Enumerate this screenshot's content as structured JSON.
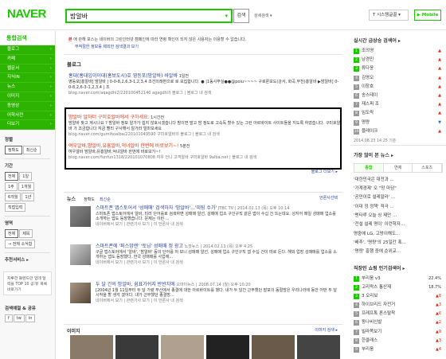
{
  "logo": "NAVER",
  "search": {
    "query": "밤알바",
    "button": "검색",
    "advanced": "상세검색 ▾"
  },
  "header": {
    "system_font": "T 시스템글꼴 ▾",
    "mobile": "▶ Mobile"
  },
  "left_nav": {
    "all": "통합검색",
    "items": [
      "블로그",
      "카페",
      "웹문서",
      "지식iN",
      "뉴스",
      "이미지",
      "동영상",
      "어학사전",
      "더보기"
    ],
    "sort_label": "정렬",
    "sort": [
      "정확도",
      "최신순"
    ],
    "period_label": "기간",
    "period": [
      "전체",
      "1일",
      "1주",
      "1개월",
      "6개월",
      "1년"
    ],
    "period_custom": "직접입력",
    "area_label": "영역",
    "area": [
      "전체",
      "제목"
    ],
    "area_custom": "→ 전체 소식함",
    "recommend_label": "추천서비스 ▸",
    "ad_text": "지루한 들텐드만 업데 달력을 TOP 10 공개! 목록 바로가기",
    "dict_label": "검색예절 & 공유",
    "share": [
      "f",
      "tw",
      "in"
    ]
  },
  "notice": {
    "text": "에 관해 포스는 네이버의 그린인터넷 캠페인에 따라 연령 확인이 되지 않은 사용자는 이용할 수 없습니다.",
    "link": "부적절한 정보를 제외한 검색결과 보기",
    "red": "본"
  },
  "blog": {
    "title": "블로그",
    "items": [
      {
        "title": "홍대(홍대입이이대(홍보도시)호 영등포(밤알바) 바알바",
        "date": "1일전",
        "desc": "영등포[홍알바] 밤알바 | 0-0-8,2,6,3-1,2,3,4 조건의래편으로 로 모집합니다. ● |1동사무실●●@poiu~~~~ 구로론보도(강서, 화곡,부천)홍알바 ▶밤알바] 0-0-8,2,6-3-1,2,3,4 | 조",
        "meta": "blog.naver.com/aqagdhl2/220100452140",
        "src": "agagdh의 블로그  |  블로그 내 검색"
      },
      {
        "title": "밤알바 알차더 구미호알바에서 구하세요.",
        "date": "1시간전",
        "desc": "밤알바 찾고 계시나요 ? 밤알바 정보 알가가 쉽지 않호시겠습니다 밤이면 발고 밤 정도로 고속독 할수 있는 그런 아르바이트 사이트들을 지도록 하였습니다. 구미호알바 가 조금합니다 지금 빨리 구사해서 알가라 얼마보세요",
        "meta": "blog.naver.com/gumihoalba/220101049590",
        "src": "구미호알바의 블로그  |  블로그 내 검색"
      },
      {
        "title": "여우알바,밤알바,유흥알바,억녀알바 한번에 바로보기~!",
        "date": "5분전",
        "desc": "여우알바 밤알바,유흥알바,억녀알바 한번에 바로보기~!",
        "meta": "blog.naver.com/funfun1318/220101070808",
        "src": "여우 언니 고객알바 구미호알바 9alba.net  |  블로그 내 검색"
      }
    ],
    "more": "블로그 더보기 ▸"
  },
  "news": {
    "title": "뉴스",
    "sort": [
      "정확도",
      "최신순"
    ],
    "more": "언론사선택",
    "items": [
      {
        "title": "스마트폰 앱스토어서 '성매매' 검색하자 '밤알바'...'미팅 수가'",
        "src": "JTBC TV  |  2014.02.13 (목) 오후 10:14",
        "desc": "스마트폰 앱스토어에서 알바, 미러 단어를로 검색하면 성매매 알선, 성매매 업소 구인구직 같은 앱이 수십 건 뜨는데요. 성지어 매일 성매매 업소를 소개하는 앱도 등장했습니다. 문제는 이런 ...",
        "foot": "네이버에서 보기  |  관련기사 보기  |  이 언론사 내 검색"
      },
      {
        "title": "스마트폰에 '퍼스맘랜' '토닝' 성매매 정 광고",
        "src": "노컷뉴스  |  2014.02.13 (목) 오후 4:25",
        "desc": "구글 앱스토어에서 '알바', '밤알바' 등의 단어를 처 보니 성매매 알선, 성매매 업소 구인구직 앱 수십 건이 떠로 든다. 해외 업장 성매매를 업소를 소개하는 앱도 등장했다. 한국 성매매를 사업에...",
        "foot": "네이버에서 보기  |  관련기사 보기  |  이 언론사 내 검색"
      },
      {
        "title": "두 달 간의 밤알바, 쉼표가쉬지 반반치에",
        "src": "오마이뉴스  |  2008.07.14 (월) 오후 10:20",
        "desc": "[2004년 1월 11일부터 두 달 가량 부산에서 종결에 대한 아르바이트를 했다. 내가 두 달간 근무했던 발포의 동절방은 우리나라에 동안 어떤 두 달 시작을 할 생각 겠어다. 내가 근무했던 종결방...",
        "foot": "네이버에서 보기  |  관련기사 보기  |  이 언론사 내 검색"
      }
    ]
  },
  "images": {
    "title": "이미지",
    "more": "이미지 검색 ▸"
  },
  "realtime": {
    "title": "실시간 급상승 검색어 ▸",
    "items": [
      {
        "n": "1",
        "k": "조의영",
        "c": "▲"
      },
      {
        "n": "2",
        "k": "남경민",
        "c": "▲"
      },
      {
        "n": "3",
        "k": "류다윤",
        "c": "▲"
      },
      {
        "n": "4",
        "k": "김영오",
        "c": "▲"
      },
      {
        "n": "5",
        "k": "이창호",
        "c": "▲"
      },
      {
        "n": "6",
        "k": "송스테이",
        "c": "▲"
      },
      {
        "n": "7",
        "k": "재스퍼 조",
        "c": "▲"
      },
      {
        "n": "8",
        "k": "임도락",
        "c": "▲"
      },
      {
        "n": "9",
        "k": "명량",
        "c": "▼"
      },
      {
        "n": "10",
        "k": "블레이크",
        "c": "▲"
      }
    ],
    "time": "2014.08.23 14:25 기준"
  },
  "popular": {
    "title": "가장 많이 본 뉴스 ▸",
    "tabs": [
      "종합",
      "연예",
      "스포츠"
    ],
    "items": [
      "'대한민국은 대전과 ...",
      "'가계경제' 오 \"망 마담\"",
      "'공민이로 설레말라' ...",
      "'이대 정 정책' 적극 ...",
      "'멘타루 오늘 싱 제안 ...",
      "'전설 설레 명이' 이런학자...",
      "명중에 LG, 고방이해도...",
      "'배추', '명량'의 25일간 폭...",
      "'명량' 흥행 중에 순위교..."
    ]
  },
  "shopping": {
    "title": "직장인 쇼핑 인기검색어 ▸",
    "items": [
      {
        "n": "1",
        "k": "부리움 v3",
        "c": "22.4%"
      },
      {
        "n": "2",
        "k": "고리락스 통산재",
        "c": "18.7%"
      },
      {
        "n": "3",
        "k": "3 오리보",
        "c": "▲8"
      },
      {
        "n": "4",
        "k": "하이브리드 자전거",
        "c": "▲3"
      },
      {
        "n": "5",
        "k": "프레프톡 론스탈착",
        "c": "▲6"
      },
      {
        "n": "6",
        "k": "동나비신발",
        "c": "▲2"
      },
      {
        "n": "7",
        "k": "빌라쪽보기",
        "c": "▲9"
      },
      {
        "n": "8",
        "k": "한클래스",
        "c": "▲3"
      },
      {
        "n": "9",
        "k": "부리움",
        "c": "▲4"
      },
      {
        "n": "10",
        "k": "아러니 여행 선정용 여수",
        "c": "▲4"
      }
    ]
  }
}
